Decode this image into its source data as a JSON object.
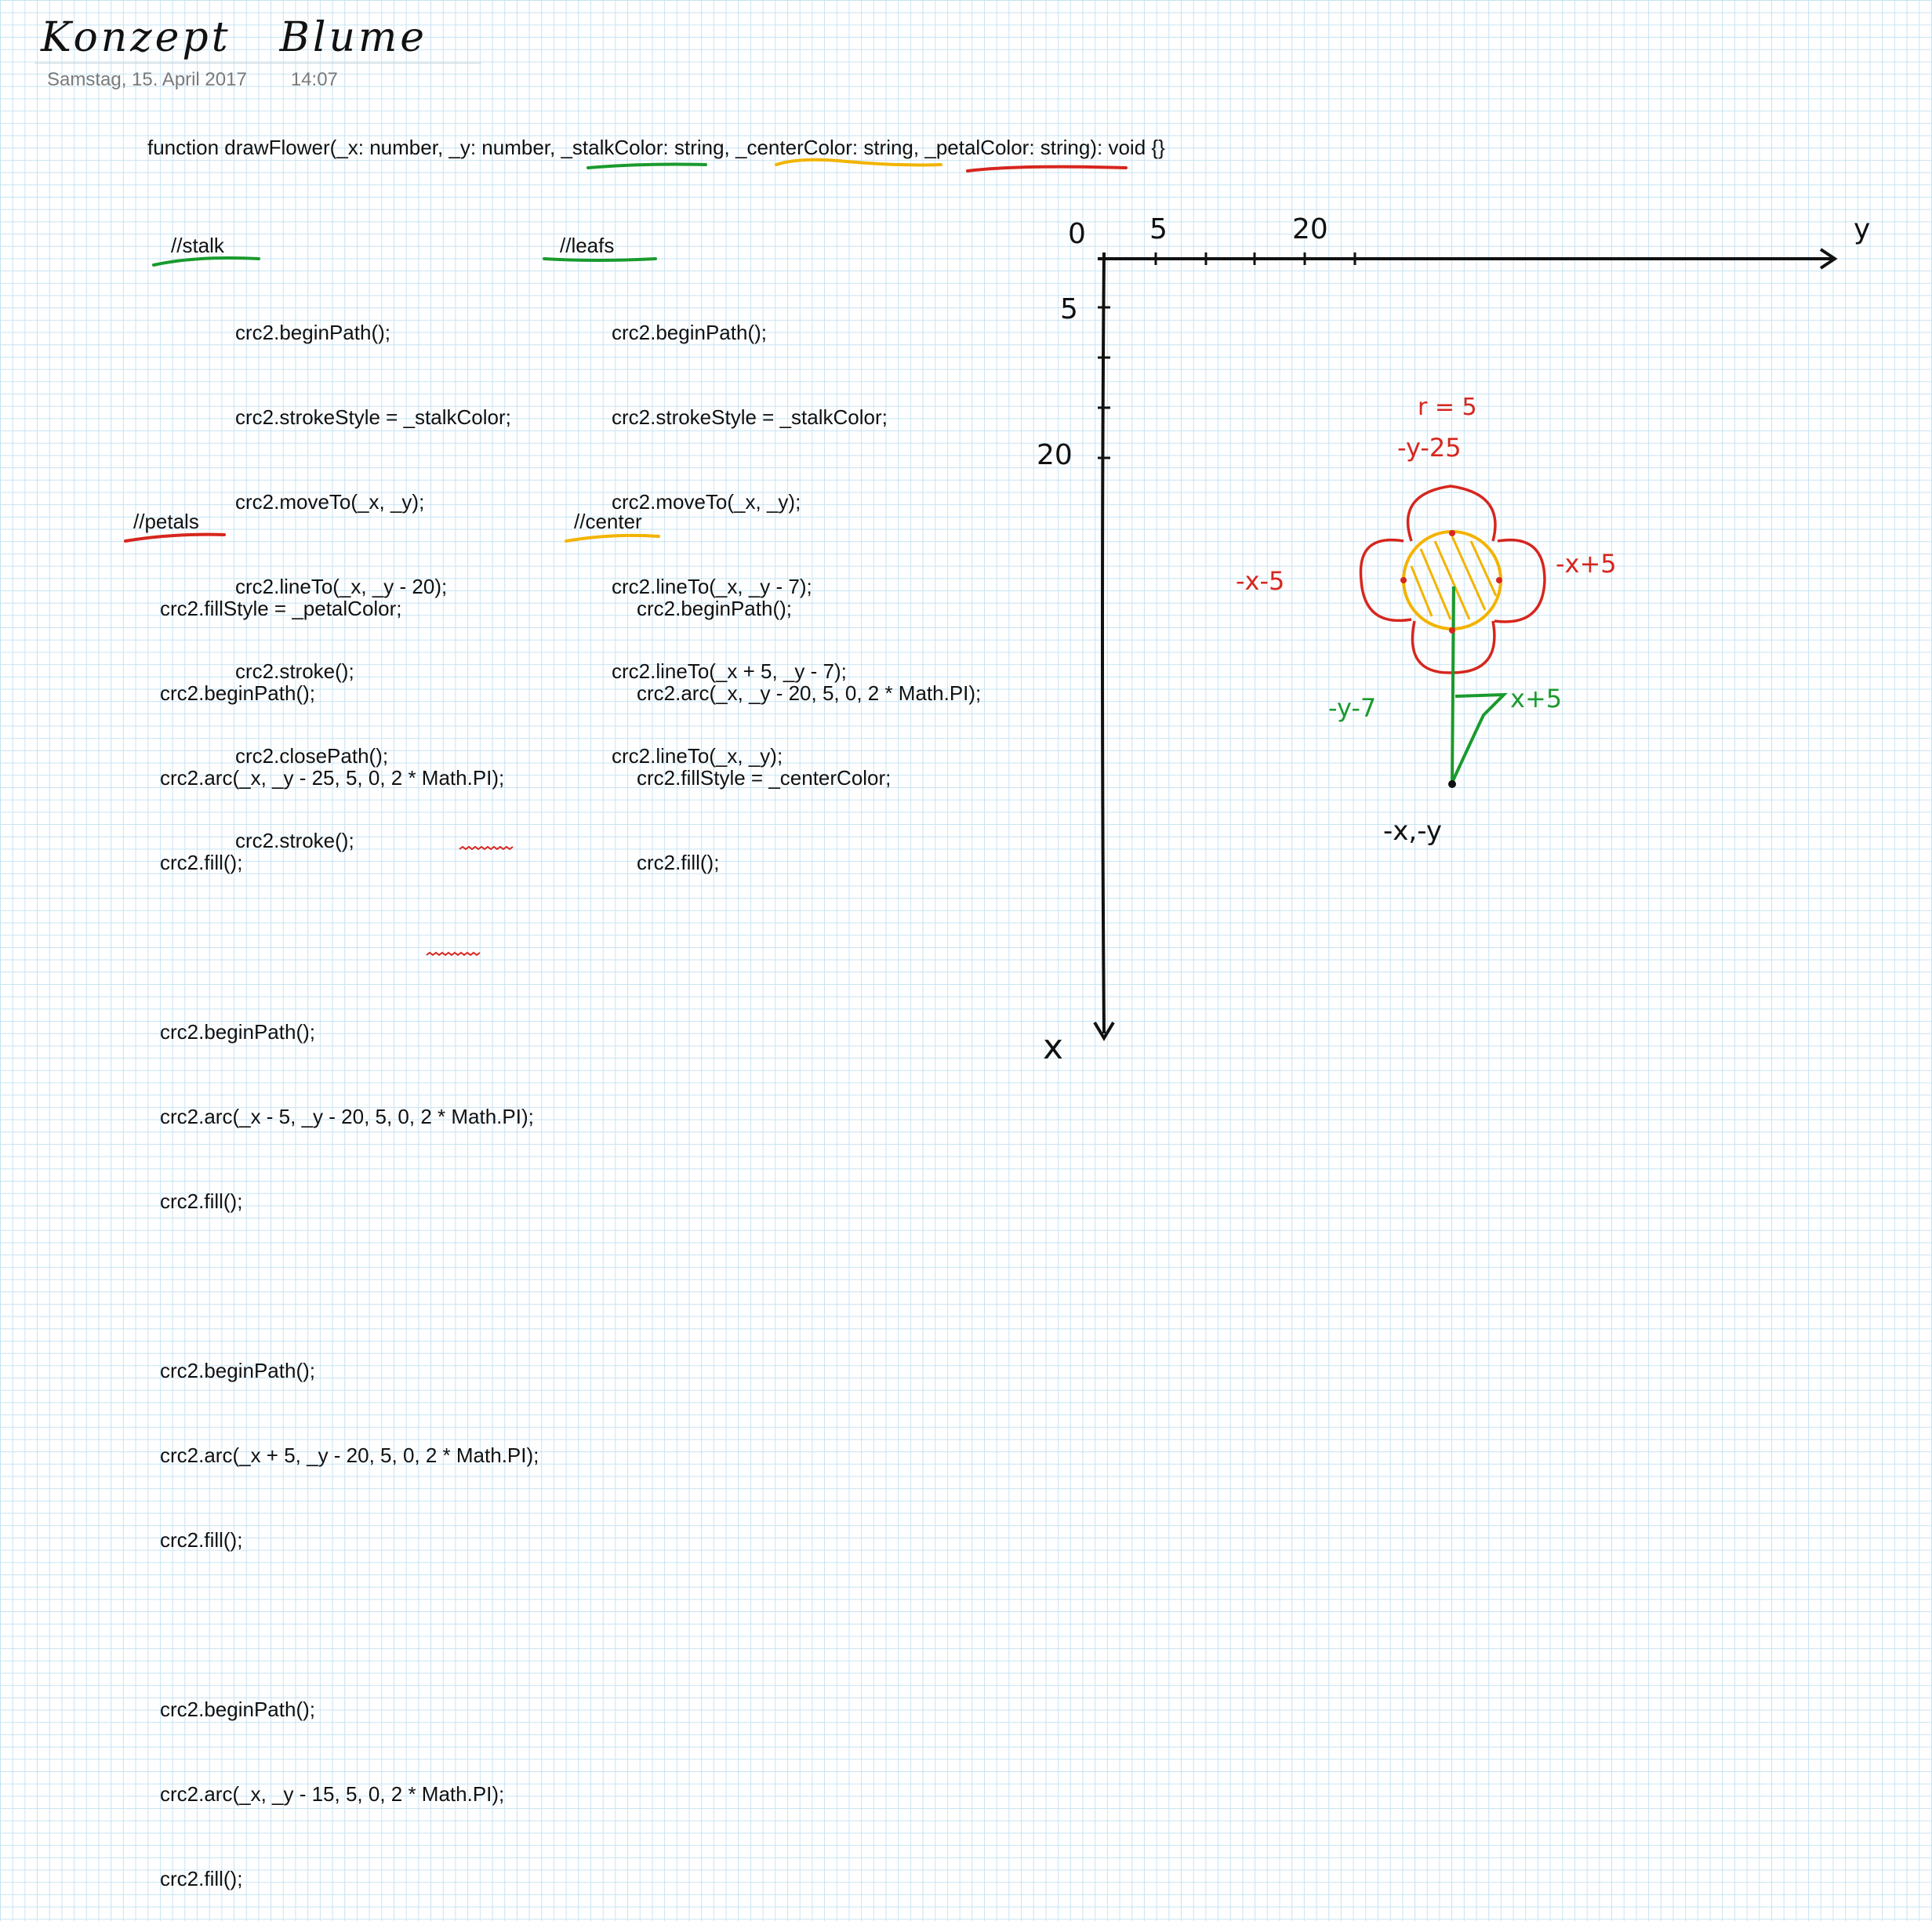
{
  "header": {
    "title_word1": "Konzept",
    "title_word2": "Blume",
    "date": "Samstag, 15. April 2017",
    "time": "14:07"
  },
  "signature": {
    "pre": "function drawFlower(_x: number, _y: number, ",
    "stalk": "_stalkColor: string,",
    "sp1": " ",
    "center": "_centerColor: string,",
    "sp2": " ",
    "petal": "_petalColor: string)",
    "post": ": void {}"
  },
  "stalk": {
    "comment": "//stalk",
    "lines": [
      "crc2.beginPath();",
      "crc2.strokeStyle = _stalkColor;",
      "crc2.moveTo(_x, _y);",
      "crc2.lineTo(_x, _y - 20);",
      "crc2.stroke();",
      "crc2.closePath();",
      "crc2.stroke();"
    ]
  },
  "leafs": {
    "comment": "//leafs",
    "lines": [
      "crc2.beginPath();",
      "crc2.strokeStyle = _stalkColor;",
      "crc2.moveTo(_x, _y);",
      "crc2.lineTo(_x, _y - 7);",
      "crc2.lineTo(_x + 5, _y - 7);",
      "crc2.lineTo(_x, _y);"
    ]
  },
  "petals": {
    "comment": "//petals",
    "lines": [
      "crc2.fillStyle = _petalColor;",
      "crc2.beginPath();",
      "crc2.arc(_x, _y - 25, 5, 0, 2 * Math.PI);",
      "crc2.fill();",
      "",
      "crc2.beginPath();",
      "crc2.arc(_x - 5, _y - 20, 5, 0, 2 * Math.PI);",
      "crc2.fill();",
      "",
      "crc2.beginPath();",
      "crc2.arc(_x + 5, _y - 20, 5, 0, 2 * Math.PI);",
      "crc2.fill();",
      "",
      "crc2.beginPath();",
      "crc2.arc(_x, _y - 15, 5, 0, 2 * Math.PI);",
      "crc2.fill();"
    ]
  },
  "center": {
    "comment": "//center",
    "lines": [
      "crc2.beginPath();",
      "crc2.arc(_x, _y - 20, 5, 0, 2 * Math.PI);",
      "crc2.fillStyle = _centerColor;",
      "crc2.fill();"
    ]
  },
  "sketch": {
    "origin": "0",
    "tick_x5": "5",
    "tick_x20": "20",
    "axis_y": "y",
    "tick_y5": "5",
    "tick_y20": "20",
    "axis_x": "x",
    "r": "r = 5",
    "top": "-y-25",
    "left": "-x-5",
    "right": "-x+5",
    "leaf_y": "-y-7",
    "leaf_x": "x+5",
    "base": "-x,-y"
  },
  "colors": {
    "stalk": "#1a9a2e",
    "center": "#f2b400",
    "petal": "#d6261e",
    "ink": "#111111"
  }
}
